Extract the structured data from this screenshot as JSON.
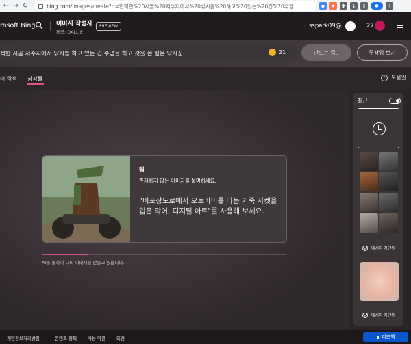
{
  "browser": {
    "url_host": "bing.com",
    "url_rest": "/images/create?q=한적한%20시골%20저수지에서%20낚시를%20하고%20있는%20긴%20수염..."
  },
  "header": {
    "logo": "rosoft Bing",
    "app_title": "이미지 작성자",
    "app_sub": "제공: DALL·E",
    "preview": "PREVIEW",
    "username": "sspark09@...",
    "coins": "27"
  },
  "prompt": {
    "text": "적한 시골 저수지에서 낚시를 하고 있는 긴 수염을 하고 갓을 쓴 젊은 낚시꾼",
    "boosts": "21",
    "create_label": "만드는 중..",
    "surprise_label": "무작위 보기"
  },
  "tabs": {
    "explore": "어 탐색",
    "creations": "창작물",
    "help": "도움말"
  },
  "tip_card": {
    "title": "팁",
    "heading": "존재하지 않는 이미지를 설명하세요.",
    "body": "\"비포장도로에서 오토바이를 타는 가죽 자켓을 입은 악어, 디지털 아트\"를 사용해 보세요."
  },
  "progress": {
    "text": "AI를 통하여 나의 이미지를 만들고 있습니다.",
    "fraction": 0.19
  },
  "recent": {
    "title": "최근",
    "toggle_on": true,
    "message_hidden_1": "메시지 차단됨",
    "message_hidden_2": "메시지 차단됨"
  },
  "footer": {
    "privacy": "개인정보처리방침",
    "content_policy": "콘텐츠 정책",
    "terms": "사용 약관",
    "more": "의견",
    "feedback": "피드백"
  },
  "colors": {
    "accent": "#d64f88",
    "feedback_blue": "#0b57d0",
    "boost_gold": "#f0b429"
  }
}
